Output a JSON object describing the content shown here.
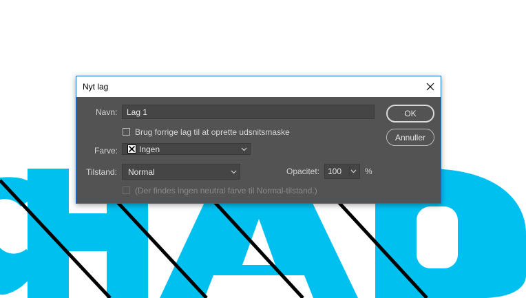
{
  "colors": {
    "canvas_fill": "#00c0f0",
    "dialog_bg": "#535353",
    "stripe": "#000000",
    "title_bar": "#ffffff"
  },
  "dialog": {
    "title": "Nyt lag",
    "close_icon": "close-icon",
    "name_label": "Navn:",
    "name_value": "Lag 1",
    "clip_checkbox_label": "Brug forrige lag til at oprette udsnitsmaske",
    "clip_checked": false,
    "color_label": "Farve:",
    "color_value": "Ingen",
    "color_icon": "no-color-x-icon",
    "mode_label": "Tilstand:",
    "mode_value": "Normal",
    "opacity_label": "Opacitet:",
    "opacity_value": "100",
    "opacity_unit": "%",
    "neutral_checkbox_label": "(Der findes ingen neutral farve til Normal-tilstand.)",
    "neutral_checked": false,
    "neutral_disabled": true,
    "ok_label": "OK",
    "cancel_label": "Annuller"
  }
}
